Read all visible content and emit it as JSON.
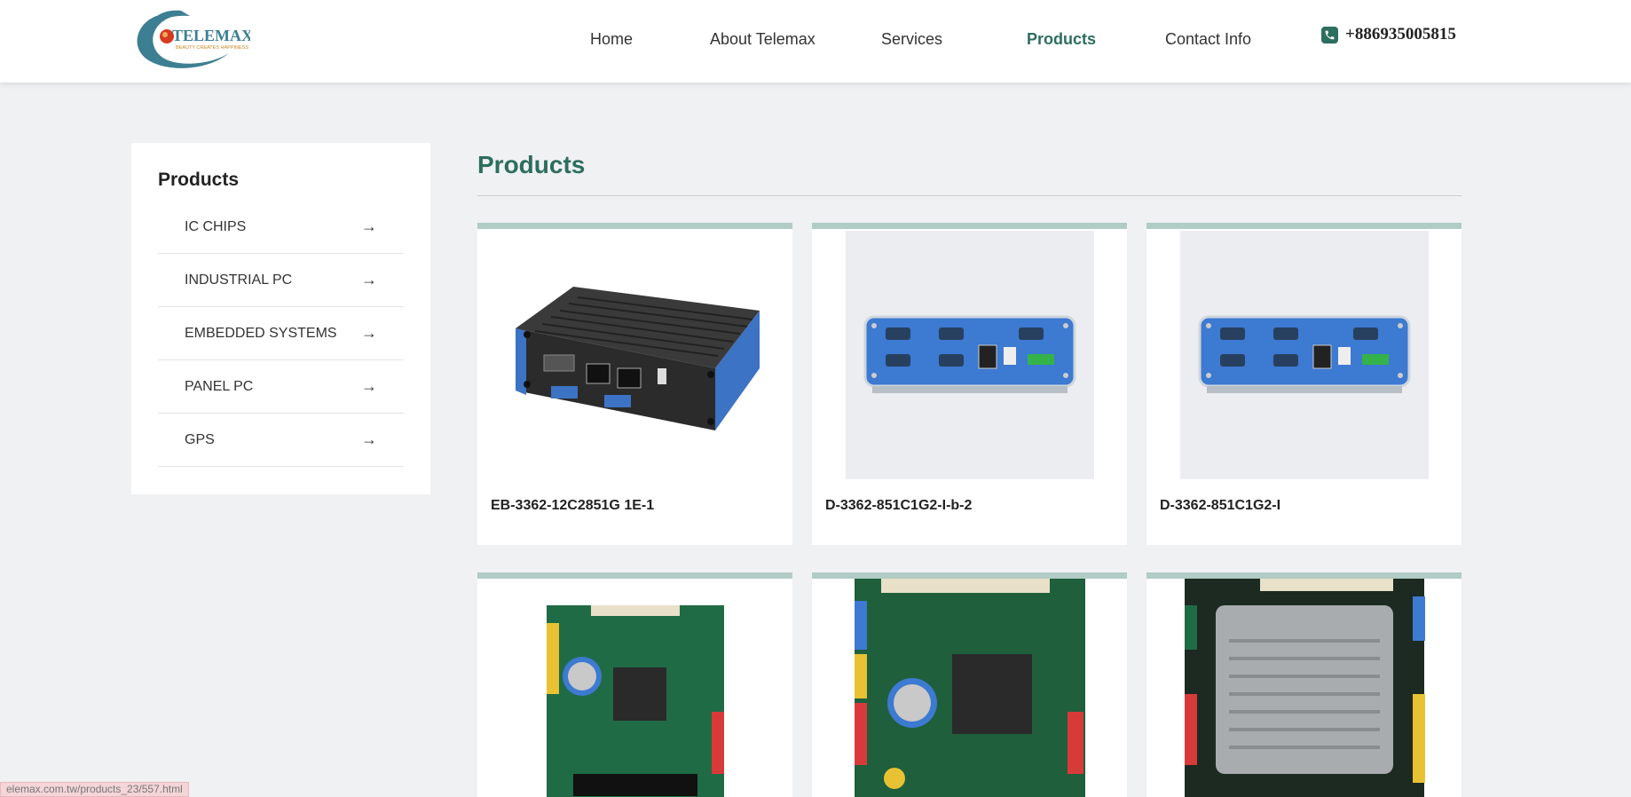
{
  "header": {
    "logo_text": "TELEMAX",
    "logo_tagline": "BEAUTY CREATES HAPPINESS",
    "nav": [
      {
        "label": "Home",
        "active": false
      },
      {
        "label": "About Telemax",
        "active": false
      },
      {
        "label": "Services",
        "active": false
      },
      {
        "label": "Products",
        "active": true
      },
      {
        "label": "Contact Info",
        "active": false
      }
    ],
    "phone": "+886935005815",
    "phone_icon": "phone-icon"
  },
  "sidebar": {
    "title": "Products",
    "arrow": "→",
    "items": [
      {
        "label": "IC CHIPS"
      },
      {
        "label": "INDUSTRIAL PC"
      },
      {
        "label": "EMBEDDED SYSTEMS"
      },
      {
        "label": "PANEL PC"
      },
      {
        "label": "GPS"
      }
    ]
  },
  "main": {
    "title": "Products",
    "products": [
      {
        "name": "EB-3362-12C2851G 1E-1",
        "image": "fanless-mini-pc"
      },
      {
        "name": "D-3362-851C1G2-I-b-2",
        "image": "blue-io-panel"
      },
      {
        "name": "D-3362-851C1G2-I",
        "image": "blue-io-panel"
      },
      {
        "name": "",
        "image": "pc104-board"
      },
      {
        "name": "",
        "image": "pc104-board"
      },
      {
        "name": "",
        "image": "pc104-board-heatsink"
      }
    ]
  },
  "status_bar": {
    "url": "elemax.com.tw/products_23/557.html"
  },
  "colors": {
    "accent": "#2d6e5e",
    "card_top": "#b1cbc5",
    "background": "#f0f1f3"
  }
}
